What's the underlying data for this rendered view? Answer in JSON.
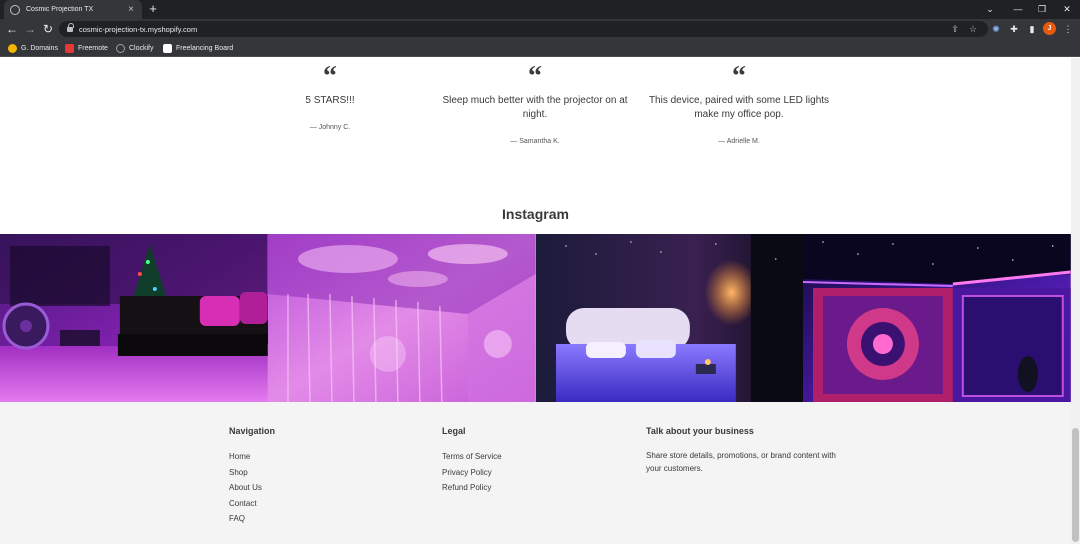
{
  "browser": {
    "tab_title": "Cosmic Projection TX",
    "tab_close": "×",
    "new_tab": "+",
    "url": "cosmic-projection-tx.myshopify.com",
    "avatar_initial": "J",
    "bookmarks": [
      {
        "label": "G. Domains",
        "icon": "google-domains-icon",
        "color": "#f4b400"
      },
      {
        "label": "Freemote",
        "icon": "freemote-icon",
        "color": "#e53935"
      },
      {
        "label": "Clockify",
        "icon": "clockify-icon",
        "color": "#9aa0a6"
      },
      {
        "label": "Freelancing Board",
        "icon": "trello-icon",
        "color": "#ffffff"
      }
    ]
  },
  "testimonials": [
    {
      "quote_mark": "“",
      "text": "5 STARS!!!",
      "author": "— Johnny C."
    },
    {
      "quote_mark": "“",
      "text": "Sleep much better with the projector on at night.",
      "author": "— Samantha K."
    },
    {
      "quote_mark": "“",
      "text": "This device, paired with some LED lights make my office pop.",
      "author": "— Adrielle M."
    }
  ],
  "instagram": {
    "title": "Instagram"
  },
  "footer": {
    "navigation": {
      "heading": "Navigation",
      "links": [
        "Home",
        "Shop",
        "About Us",
        "Contact",
        "FAQ"
      ]
    },
    "legal": {
      "heading": "Legal",
      "links": [
        "Terms of Service",
        "Privacy Policy",
        "Refund Policy"
      ]
    },
    "business": {
      "heading": "Talk about your business",
      "text": "Share store details, promotions, or brand content with your customers."
    }
  },
  "colors": {
    "chrome_dark": "#202124",
    "chrome_toolbar": "#35363a",
    "footer_bg": "#f5f4f4",
    "text": "#3a3a3a"
  }
}
